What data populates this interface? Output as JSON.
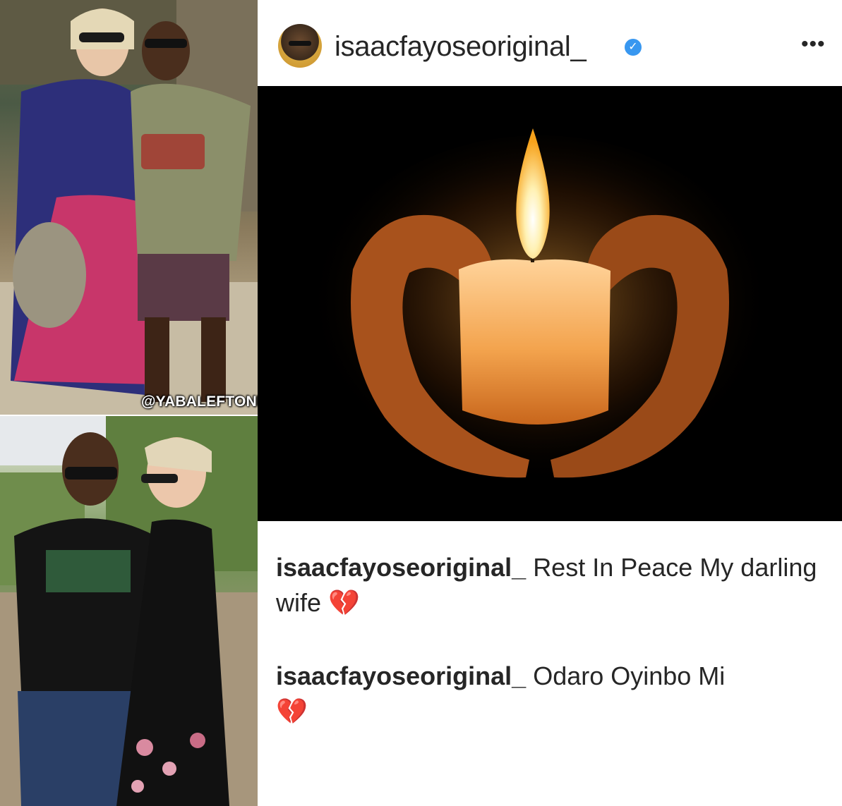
{
  "watermark": "@YABALEFTONLINE",
  "post": {
    "username": "isaacfayoseoriginal_",
    "verified_icon": "verified-check-icon",
    "more_icon": "more-options-icon",
    "more_glyph": "•••",
    "media_description_icon": "candle-in-hands-image"
  },
  "comments": [
    {
      "username": "isaacfayoseoriginal_",
      "text": "Rest In Peace My darling wife",
      "emoji": "💔"
    },
    {
      "username": "isaacfayoseoriginal_",
      "text": "Odaro Oyinbo Mi",
      "emoji": "💔"
    }
  ],
  "colors": {
    "text": "#262626",
    "verified": "#3897f0",
    "media_bg": "#000000",
    "broken_heart": "#d6283b"
  }
}
